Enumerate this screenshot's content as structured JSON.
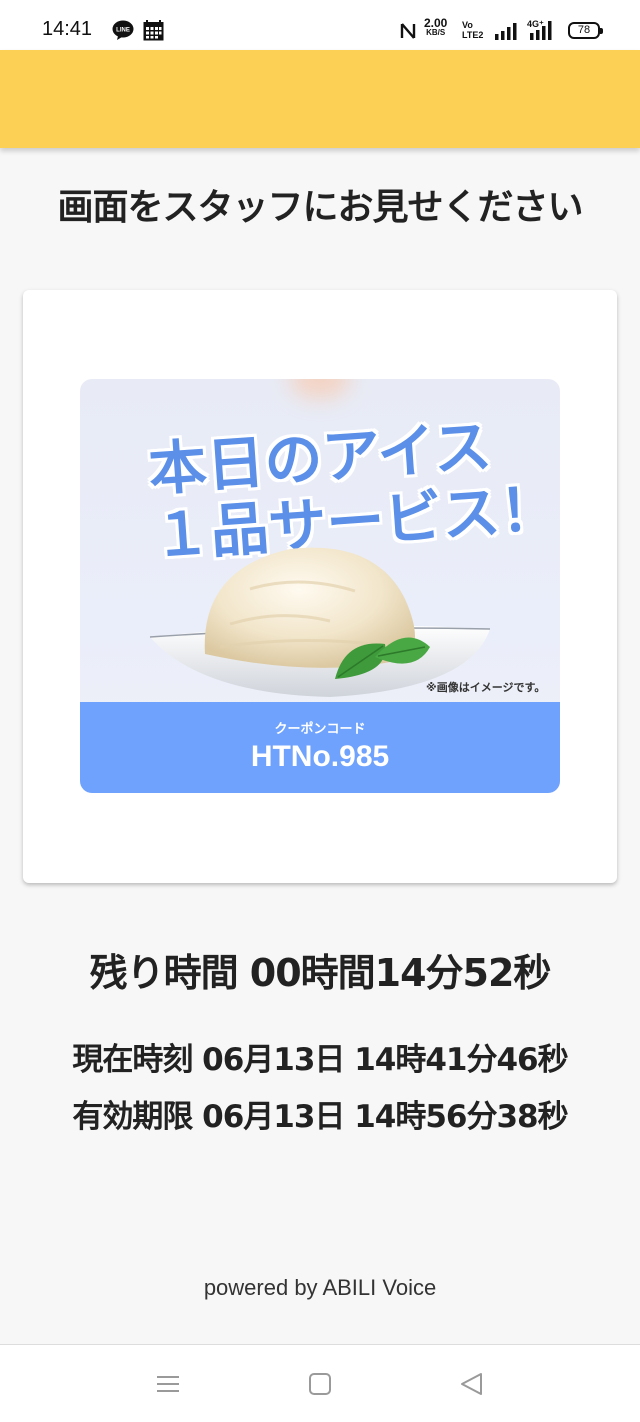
{
  "status_bar": {
    "time": "14:41",
    "net_speed": "2.00",
    "net_unit": "KB/S",
    "volte_top": "Vo",
    "volte_bottom": "LTE2",
    "battery": "78",
    "icons": [
      "line-icon",
      "calendar-icon",
      "nfc-icon",
      "signal-icon",
      "4g-signal-icon",
      "battery-icon"
    ]
  },
  "header": {
    "color": "#fccf55"
  },
  "instruction": "画面をスタッフにお見せください",
  "coupon": {
    "headline_line1": "本日のアイス",
    "headline_line2": "１品サービス！",
    "image_note": "※画像はイメージです。",
    "code_label": "クーポンコード",
    "code_value": "HTNo.985",
    "band_color": "#6fa2fd",
    "headline_color": "#5b8fe8"
  },
  "time_info": {
    "remaining": "残り時間 00時間14分52秒",
    "current": "現在時刻 06月13日 14時41分46秒",
    "expiry": "有効期限 06月13日 14時56分38秒"
  },
  "footer": {
    "powered_by": "powered by ABILI Voice"
  },
  "nav_bar": {
    "icons": [
      "menu-icon",
      "home-icon",
      "back-icon"
    ]
  }
}
